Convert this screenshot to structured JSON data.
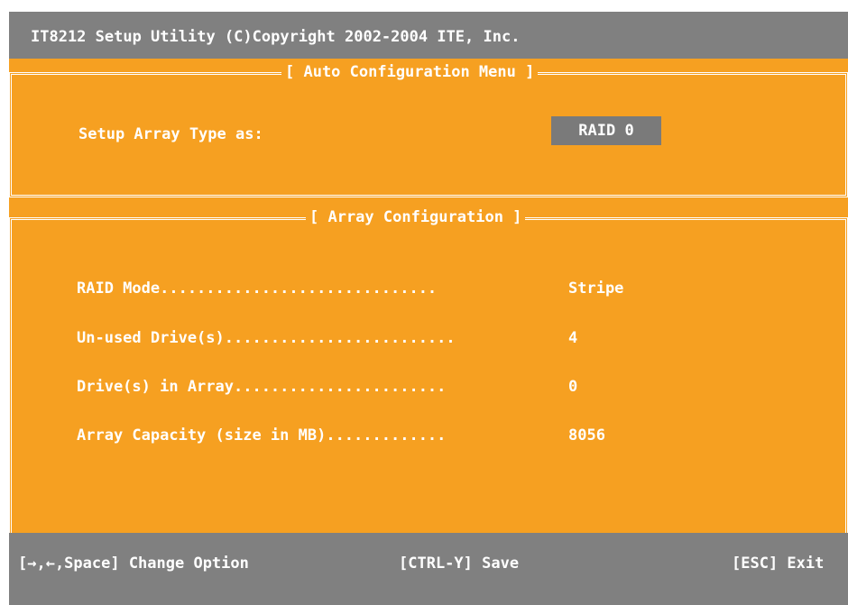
{
  "header": {
    "title": "IT8212 Setup Utility (C)Copyright 2002-2004 ITE, Inc."
  },
  "auto_menu": {
    "title": "[ Auto Configuration Menu ]",
    "setup_label": "Setup Array Type as:",
    "setup_value": "RAID 0"
  },
  "array_config": {
    "title": "[ Array Configuration ]",
    "rows": [
      {
        "label": "RAID Mode..............................",
        "value": "Stripe"
      },
      {
        "label": "Un-used Drive(s).........................",
        "value": "4"
      },
      {
        "label": "Drive(s) in Array.......................",
        "value": "0"
      },
      {
        "label": "Array Capacity (size in MB).............",
        "value": "8056"
      }
    ]
  },
  "footer": {
    "change_option": "[→,←,Space] Change Option",
    "save": "[CTRL-Y] Save",
    "exit": "[ESC] Exit"
  },
  "colors": {
    "background": "#f6a021",
    "bar": "#808080",
    "text": "#ffffff",
    "selected": "#7a7a7a"
  }
}
